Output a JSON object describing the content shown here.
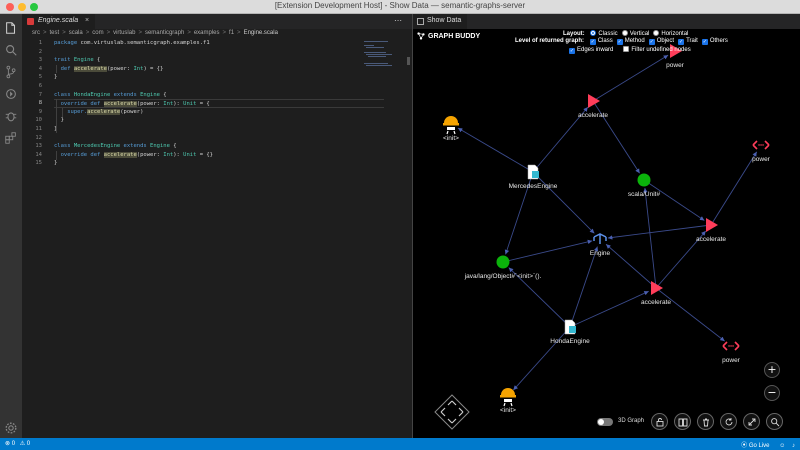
{
  "window": {
    "title": "[Extension Development Host] - Show Data — semantic-graphs-server"
  },
  "editor_tab": {
    "label": "Engine.scala",
    "close": "×"
  },
  "editor_actions": "⋯",
  "breadcrumb": {
    "items": [
      "src",
      "test",
      "scala",
      "com",
      "virtuslab",
      "semanticgraph",
      "examples",
      "f1"
    ],
    "file": "Engine.scala",
    "separator": ">"
  },
  "code": {
    "line_numbers": [
      "1",
      "2",
      "3",
      "4",
      "5",
      "6",
      "7",
      "8",
      "9",
      "10",
      "11",
      "12",
      "13",
      "14",
      "15"
    ],
    "active_line": 8,
    "lines": [
      [
        {
          "t": "package ",
          "c": "kw"
        },
        {
          "t": "com.virtuslab.semanticgraph.examples.f1",
          "c": ""
        }
      ],
      [],
      [
        {
          "t": "trait ",
          "c": "kw"
        },
        {
          "t": "Engine",
          "c": "ty"
        },
        {
          "t": " {",
          "c": ""
        }
      ],
      [
        {
          "t": "  def ",
          "c": "kw"
        },
        {
          "t": "accelerate",
          "c": "fn hlw"
        },
        {
          "t": "(power: ",
          "c": ""
        },
        {
          "t": "Int",
          "c": "ty"
        },
        {
          "t": ") = {}",
          "c": ""
        }
      ],
      [
        {
          "t": "}",
          "c": ""
        }
      ],
      [],
      [
        {
          "t": "class ",
          "c": "kw"
        },
        {
          "t": "HondaEngine ",
          "c": "ty"
        },
        {
          "t": "extends ",
          "c": "kw"
        },
        {
          "t": "Engine",
          "c": "ty"
        },
        {
          "t": " {",
          "c": ""
        }
      ],
      [
        {
          "t": "  override def ",
          "c": "kw"
        },
        {
          "t": "accelerate",
          "c": "fn hlw"
        },
        {
          "t": "(power: ",
          "c": ""
        },
        {
          "t": "Int",
          "c": "ty"
        },
        {
          "t": "): ",
          "c": ""
        },
        {
          "t": "Unit",
          "c": "ty"
        },
        {
          "t": " = {",
          "c": ""
        }
      ],
      [
        {
          "t": "    super.",
          "c": "kw"
        },
        {
          "t": "accelerate",
          "c": "fn hlw"
        },
        {
          "t": "(power)",
          "c": ""
        }
      ],
      [
        {
          "t": "  }",
          "c": ""
        }
      ],
      [
        {
          "t": "}",
          "c": ""
        }
      ],
      [],
      [
        {
          "t": "class ",
          "c": "kw"
        },
        {
          "t": "MercedesEngine ",
          "c": "ty"
        },
        {
          "t": "extends ",
          "c": "kw"
        },
        {
          "t": "Engine",
          "c": "ty"
        },
        {
          "t": " {",
          "c": ""
        }
      ],
      [
        {
          "t": "  override def ",
          "c": "kw"
        },
        {
          "t": "accelerate",
          "c": "fn hlw"
        },
        {
          "t": "(power: ",
          "c": ""
        },
        {
          "t": "Int",
          "c": "ty"
        },
        {
          "t": "): ",
          "c": ""
        },
        {
          "t": "Unit",
          "c": "ty"
        },
        {
          "t": " = {}",
          "c": ""
        }
      ],
      [
        {
          "t": "}",
          "c": ""
        }
      ]
    ]
  },
  "graph_tab": {
    "label": "Show Data"
  },
  "graph_buddy": {
    "brand": "GRAPH BUDDY",
    "layout_label": "Layout:",
    "layout_options": [
      {
        "label": "Classic",
        "selected": true
      },
      {
        "label": "Vertical",
        "selected": false
      },
      {
        "label": "Horizontal",
        "selected": false
      }
    ],
    "level_label": "Level of returned graph:",
    "level_options": [
      {
        "label": "Class",
        "checked": true
      },
      {
        "label": "Method",
        "checked": true
      },
      {
        "label": "Object",
        "checked": true
      },
      {
        "label": "Trait",
        "checked": true
      },
      {
        "label": "Others",
        "checked": true
      }
    ],
    "extra_options": [
      {
        "label": "Edges inward",
        "checked": true
      },
      {
        "label": "Filter undefined nodes",
        "checked": false
      }
    ],
    "toggle_3d_label": "3D Graph",
    "zoom_in": "+",
    "zoom_out": "−"
  },
  "graph": {
    "nodes": [
      {
        "id": "power_top",
        "label": "power",
        "kind": "method"
      },
      {
        "id": "accel1",
        "label": "accelerate",
        "kind": "method"
      },
      {
        "id": "init1",
        "label": "<init>",
        "kind": "constructor"
      },
      {
        "id": "power_r",
        "label": "power",
        "kind": "parameter"
      },
      {
        "id": "mercedes",
        "label": "MercedesEngine",
        "kind": "class"
      },
      {
        "id": "unit",
        "label": "scala/Unit#",
        "kind": "object"
      },
      {
        "id": "accel2",
        "label": "accelerate",
        "kind": "method"
      },
      {
        "id": "engine",
        "label": "Engine",
        "kind": "trait"
      },
      {
        "id": "object",
        "label": "java/lang/Object#`<init>`().",
        "kind": "object"
      },
      {
        "id": "accel3",
        "label": "accelerate",
        "kind": "method"
      },
      {
        "id": "honda",
        "label": "HondaEngine",
        "kind": "class"
      },
      {
        "id": "power_b",
        "label": "power",
        "kind": "parameter"
      },
      {
        "id": "init2",
        "label": "<init>",
        "kind": "constructor"
      }
    ],
    "edges": [
      [
        "accel1",
        "power_top"
      ],
      [
        "mercedes",
        "accel1"
      ],
      [
        "accel1",
        "unit"
      ],
      [
        "mercedes",
        "init1"
      ],
      [
        "mercedes",
        "engine"
      ],
      [
        "mercedes",
        "object"
      ],
      [
        "unit",
        "accel2"
      ],
      [
        "accel2",
        "power_r"
      ],
      [
        "accel2",
        "engine"
      ],
      [
        "accel3",
        "accel2"
      ],
      [
        "accel3",
        "unit"
      ],
      [
        "accel3",
        "engine"
      ],
      [
        "honda",
        "accel3"
      ],
      [
        "honda",
        "engine"
      ],
      [
        "honda",
        "object"
      ],
      [
        "honda",
        "init2"
      ],
      [
        "accel3",
        "power_b"
      ],
      [
        "object",
        "engine"
      ]
    ],
    "colors": {
      "method": "#ff3d5a",
      "object": "#0bb30b",
      "parameter": "#ff3d5a",
      "edge": "#3a4a8a",
      "class": "#35b8d0",
      "constructor": "#f5a300"
    }
  },
  "status": {
    "errors": "0",
    "warnings": "0",
    "go_live": "Go Live"
  }
}
